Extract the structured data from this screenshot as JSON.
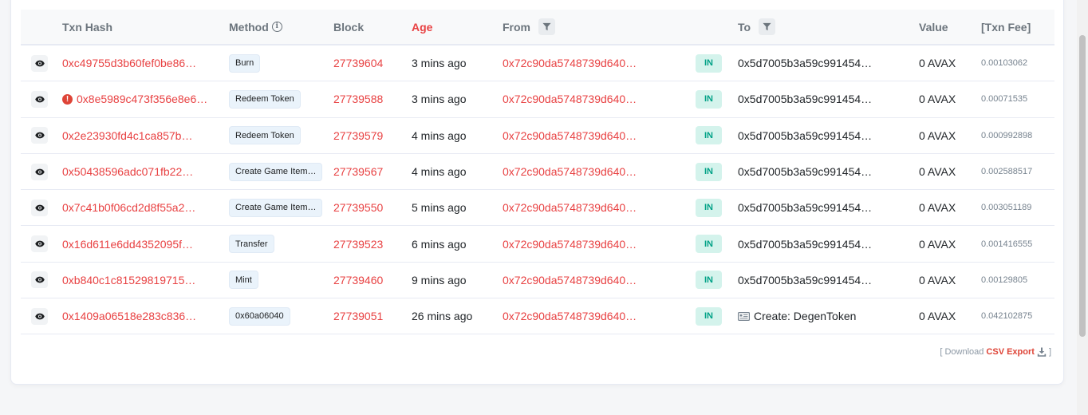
{
  "header": {
    "txn_hash": "Txn Hash",
    "method": "Method",
    "block": "Block",
    "age": "Age",
    "from": "From",
    "to": "To",
    "value": "Value",
    "txn_fee": "[Txn Fee]"
  },
  "rows": [
    {
      "hash": "0xc49755d3b60fef0be86…",
      "error": false,
      "method": "Burn",
      "block": "27739604",
      "age": "3 mins ago",
      "from": "0x72c90da5748739d640…",
      "direction": "IN",
      "to": "0x5d7005b3a59c991454…",
      "to_is_contract": false,
      "value": "0 AVAX",
      "fee": "0.00103062"
    },
    {
      "hash": "0x8e5989c473f356e8e6…",
      "error": true,
      "method": "Redeem Token",
      "block": "27739588",
      "age": "3 mins ago",
      "from": "0x72c90da5748739d640…",
      "direction": "IN",
      "to": "0x5d7005b3a59c991454…",
      "to_is_contract": false,
      "value": "0 AVAX",
      "fee": "0.00071535"
    },
    {
      "hash": "0x2e23930fd4c1ca857b…",
      "error": false,
      "method": "Redeem Token",
      "block": "27739579",
      "age": "4 mins ago",
      "from": "0x72c90da5748739d640…",
      "direction": "IN",
      "to": "0x5d7005b3a59c991454…",
      "to_is_contract": false,
      "value": "0 AVAX",
      "fee": "0.000992898"
    },
    {
      "hash": "0x50438596adc071fb22…",
      "error": false,
      "method": "Create Game Item…",
      "block": "27739567",
      "age": "4 mins ago",
      "from": "0x72c90da5748739d640…",
      "direction": "IN",
      "to": "0x5d7005b3a59c991454…",
      "to_is_contract": false,
      "value": "0 AVAX",
      "fee": "0.002588517"
    },
    {
      "hash": "0x7c41b0f06cd2d8f55a2…",
      "error": false,
      "method": "Create Game Item…",
      "block": "27739550",
      "age": "5 mins ago",
      "from": "0x72c90da5748739d640…",
      "direction": "IN",
      "to": "0x5d7005b3a59c991454…",
      "to_is_contract": false,
      "value": "0 AVAX",
      "fee": "0.003051189"
    },
    {
      "hash": "0x16d611e6dd4352095f…",
      "error": false,
      "method": "Transfer",
      "block": "27739523",
      "age": "6 mins ago",
      "from": "0x72c90da5748739d640…",
      "direction": "IN",
      "to": "0x5d7005b3a59c991454…",
      "to_is_contract": false,
      "value": "0 AVAX",
      "fee": "0.001416555"
    },
    {
      "hash": "0xb840c1c81529819715…",
      "error": false,
      "method": "Mint",
      "block": "27739460",
      "age": "9 mins ago",
      "from": "0x72c90da5748739d640…",
      "direction": "IN",
      "to": "0x5d7005b3a59c991454…",
      "to_is_contract": false,
      "value": "0 AVAX",
      "fee": "0.00129805"
    },
    {
      "hash": "0x1409a06518e283c836…",
      "error": false,
      "method": "0x60a06040",
      "block": "27739051",
      "age": "26 mins ago",
      "from": "0x72c90da5748739d640…",
      "direction": "IN",
      "to": "Create: DegenToken",
      "to_is_contract": true,
      "value": "0 AVAX",
      "fee": "0.042102875"
    }
  ],
  "footer": {
    "download_prefix": "[ Download",
    "csv_export": "CSV Export",
    "suffix": "]"
  },
  "colors": {
    "accent": "#e84142",
    "in_badge_bg": "#d4f3ec",
    "in_badge_text": "#00a186",
    "error": "#de4437"
  }
}
